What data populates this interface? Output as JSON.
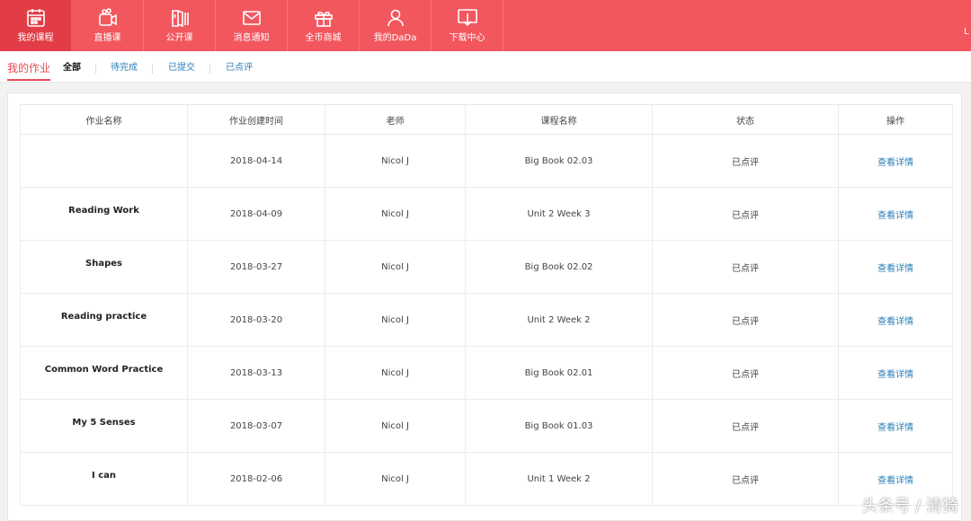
{
  "nav": {
    "items": [
      {
        "label": "我的课程",
        "icon": "calendar-icon",
        "active": true
      },
      {
        "label": "直播课",
        "icon": "live-camera-icon",
        "active": false
      },
      {
        "label": "公开课",
        "icon": "open-book-icon",
        "active": false
      },
      {
        "label": "消息通知",
        "icon": "mail-icon",
        "active": false
      },
      {
        "label": "全币商城",
        "icon": "gift-icon",
        "active": false
      },
      {
        "label": "我的DaDa",
        "icon": "user-icon",
        "active": false
      },
      {
        "label": "下载中心",
        "icon": "download-monitor-icon",
        "active": false
      }
    ],
    "edge_text": "L"
  },
  "page": {
    "title": "我的作业",
    "tabs": [
      {
        "label": "全部",
        "active": true
      },
      {
        "label": "待完成",
        "active": false
      },
      {
        "label": "已提交",
        "active": false
      },
      {
        "label": "已点评",
        "active": false
      }
    ]
  },
  "table": {
    "headers": [
      "作业名称",
      "作业创建时间",
      "老师",
      "课程名称",
      "状态",
      "操作"
    ],
    "rows": [
      {
        "name": "",
        "date": "2018-04-14",
        "teacher": "Nicol J",
        "course": "Big Book 02.03",
        "status": "已点评",
        "action": "查看详情"
      },
      {
        "name": "Reading Work",
        "date": "2018-04-09",
        "teacher": "Nicol J",
        "course": "Unit 2 Week 3",
        "status": "已点评",
        "action": "查看详情"
      },
      {
        "name": "Shapes",
        "date": "2018-03-27",
        "teacher": "Nicol J",
        "course": "Big Book 02.02",
        "status": "已点评",
        "action": "查看详情"
      },
      {
        "name": "Reading practice",
        "date": "2018-03-20",
        "teacher": "Nicol J",
        "course": "Unit 2 Week 2",
        "status": "已点评",
        "action": "查看详情"
      },
      {
        "name": "Common Word Practice",
        "date": "2018-03-13",
        "teacher": "Nicol J",
        "course": "Big Book 02.01",
        "status": "已点评",
        "action": "查看详情"
      },
      {
        "name": "My 5 Senses",
        "date": "2018-03-07",
        "teacher": "Nicol J",
        "course": "Big Book 01.03",
        "status": "已点评",
        "action": "查看详情"
      },
      {
        "name": "I can",
        "date": "2018-02-06",
        "teacher": "Nicol J",
        "course": "Unit 1 Week 2",
        "status": "已点评",
        "action": "查看详情"
      }
    ]
  },
  "watermark": "头条号 / 清猗",
  "colors": {
    "brand": "#f2575e",
    "brand_active": "#e23d46",
    "link": "#2a7fb8",
    "accent_text": "#e84b53"
  }
}
